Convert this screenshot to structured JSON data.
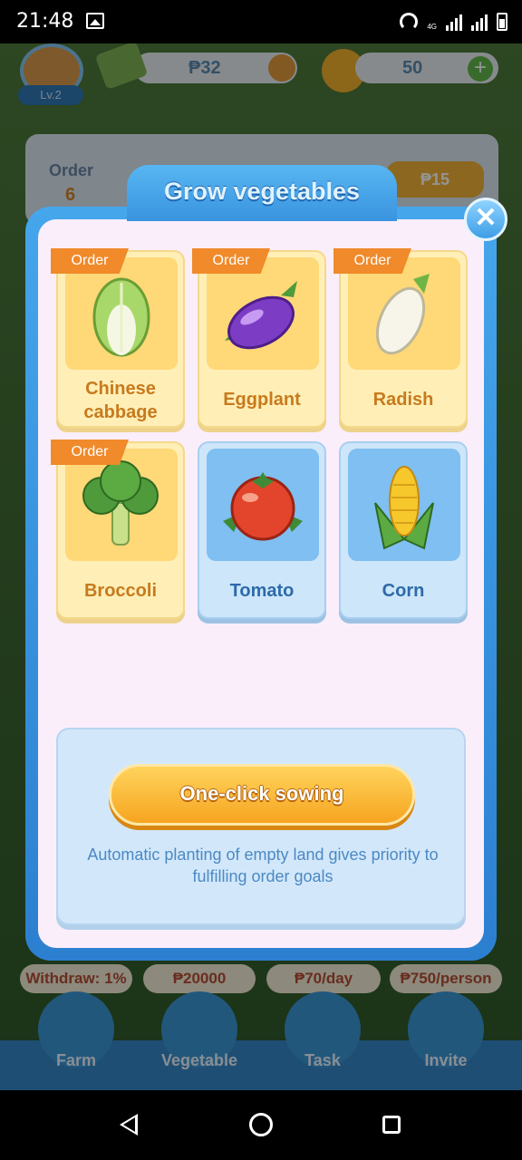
{
  "status_bar": {
    "time": "21:48",
    "network": "4G"
  },
  "hud": {
    "level": "Lv.2",
    "money": "₱32",
    "coins": "50",
    "plus": "+"
  },
  "order_strip": {
    "label": "Order",
    "count": "6",
    "price": "₱15"
  },
  "dialog": {
    "title": "Grow vegetables",
    "close": "✕",
    "badge": "Order",
    "cards": [
      {
        "name": "Chinese cabbage",
        "order": true,
        "icon": "chinese-cabbage-icon"
      },
      {
        "name": "Eggplant",
        "order": true,
        "icon": "eggplant-icon"
      },
      {
        "name": "Radish",
        "order": true,
        "icon": "radish-icon"
      },
      {
        "name": "Broccoli",
        "order": true,
        "icon": "broccoli-icon"
      },
      {
        "name": "Tomato",
        "order": false,
        "icon": "tomato-icon"
      },
      {
        "name": "Corn",
        "order": false,
        "icon": "corn-icon"
      }
    ],
    "sow_button": "One-click sowing",
    "sow_note": "Automatic planting of empty land gives priority to fulfilling order goals"
  },
  "bottom_pills": [
    "Withdraw: 1%",
    "₱20000",
    "₱70/day",
    "₱750/person"
  ],
  "bottom_nav": [
    "Farm",
    "Vegetable",
    "Task",
    "Invite"
  ],
  "colors": {
    "dialog_frame": "#3a94df",
    "dialog_bg": "#fbeefb",
    "order_card": "#ffefb7",
    "plain_card": "#cde6fa",
    "badge": "#f08a2a",
    "sow_button": "#f6a520"
  }
}
